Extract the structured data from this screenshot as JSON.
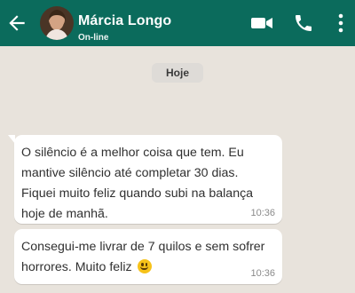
{
  "header": {
    "contact_name": "Márcia Longo",
    "status": "On-line",
    "icons": [
      "back-arrow-icon",
      "avatar",
      "video-call-icon",
      "phone-icon",
      "more-options-icon"
    ],
    "colors": {
      "bar": "#0b6b5c",
      "text": "#ffffff"
    }
  },
  "chat": {
    "date_chip": "Hoje",
    "messages": [
      {
        "text": "O silêncio é a melhor coisa que tem. Eu mantive silêncio até completar 30 dias. Fiquei muito feliz quando subi na balança hoje de manhã.",
        "time": "10:36"
      },
      {
        "text": "Consegui-me livrar de 7 quilos e sem sofrer horrores. Muito feliz",
        "emoji": "grinning-face-emoji",
        "time": "10:36"
      }
    ],
    "colors": {
      "background": "#e8e3dc",
      "bubble": "#ffffff"
    }
  }
}
